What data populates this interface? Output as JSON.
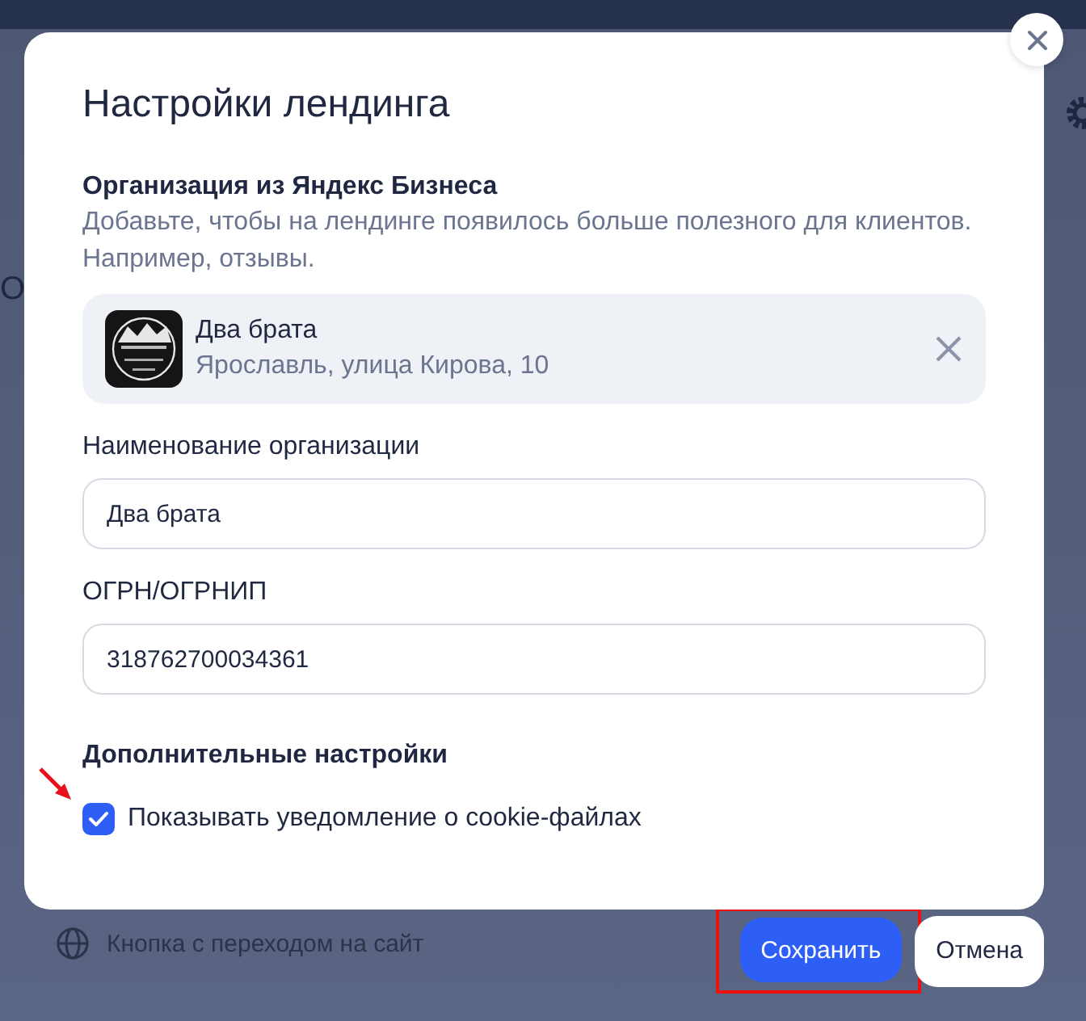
{
  "background": {
    "side_fragment": "О",
    "site_button": "Кнопка с переходом на сайт"
  },
  "dialog": {
    "title": "Настройки лендинга",
    "organization": {
      "heading": "Организация из Яндекс Бизнеса",
      "description": "Добавьте, чтобы на лендинге появилось больше полезного для клиентов. Например, отзывы.",
      "name": "Два брата",
      "address": "Ярославль, улица Кирова, 10"
    },
    "fields": [
      {
        "label": "Наименование организации",
        "value": "Два брата"
      },
      {
        "label": "ОГРН/ОГРНИП",
        "value": "318762700034361"
      }
    ],
    "extra_heading": "Дополнительные настройки",
    "options": [
      {
        "label": "Показывать уведомление о cookie-файлах",
        "checked": true
      }
    ]
  },
  "actions": [
    {
      "label": "Сохранить",
      "kind": "primary",
      "highlighted": true
    },
    {
      "label": "Отмена",
      "kind": "secondary",
      "highlighted": false
    }
  ]
}
